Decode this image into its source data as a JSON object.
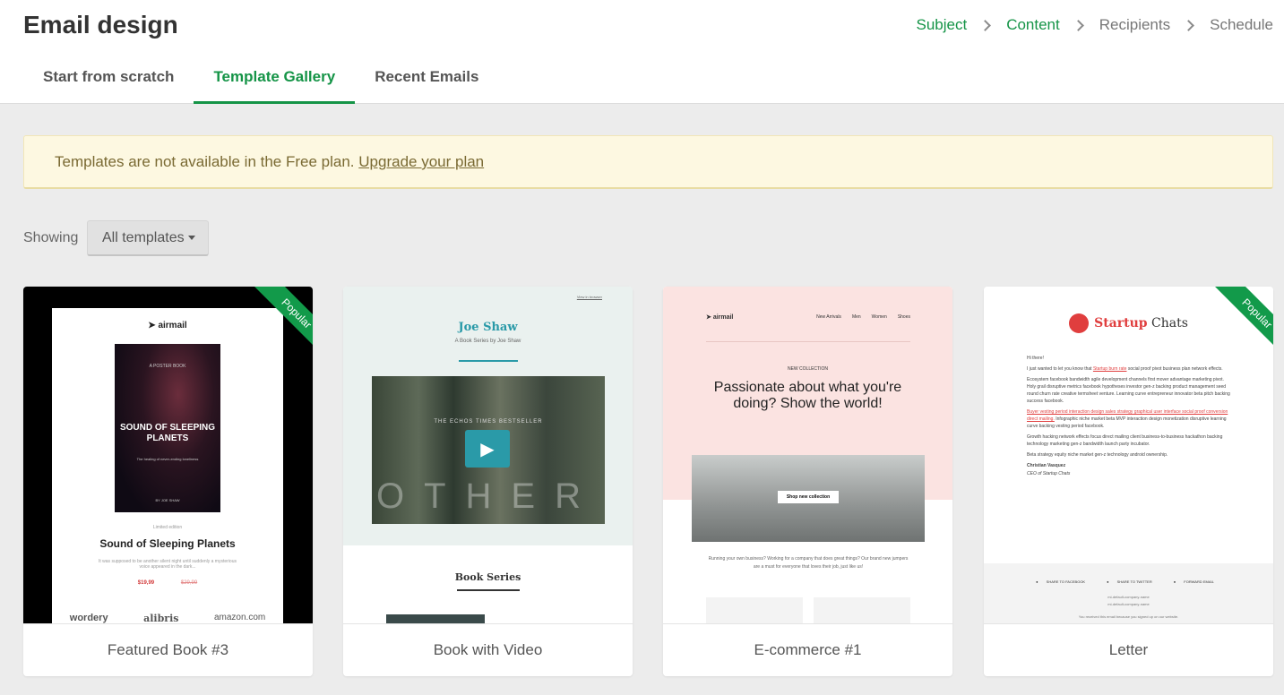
{
  "header": {
    "title": "Email design",
    "steps": [
      {
        "label": "Subject"
      },
      {
        "label": "Content"
      },
      {
        "label": "Recipients"
      },
      {
        "label": "Schedule"
      }
    ],
    "tabs": [
      {
        "label": "Start from scratch"
      },
      {
        "label": "Template Gallery"
      },
      {
        "label": "Recent Emails"
      }
    ],
    "active_tab": "Template Gallery"
  },
  "banner": {
    "text": "Templates are not available in the Free plan.",
    "link": "Upgrade your plan"
  },
  "filter": {
    "label": "Showing",
    "selected": "All templates"
  },
  "colors": {
    "accent": "#159447",
    "banner_bg": "#fdf8e1",
    "ribbon": "#129a4a"
  },
  "templates": [
    {
      "name": "Featured Book #3",
      "badge": "Popular",
      "preview": {
        "logo": "airmail",
        "cover_label": "A POSTER BOOK",
        "cover_title": "SOUND OF SLEEPING PLANETS",
        "cover_tagline": "The healing of never-ending loneliness",
        "cover_author": "BY JOE SHAW",
        "edition": "Limited edition",
        "book_title": "Sound of Sleeping Planets",
        "description": "It was supposed to be another silent night until suddenly a mysterious voice appeared in the dark...",
        "price": "$19,99",
        "old_price": "$29,99",
        "brands": [
          "wordery",
          "alibris",
          "amazon.com"
        ]
      }
    },
    {
      "name": "Book with Video",
      "badge": "",
      "preview": {
        "view_link": "View in browser",
        "author": "Joe Shaw",
        "subtitle": "A Book Series by Joe Shaw",
        "video_caption": "THE ECHOS TIMES BESTSELLER",
        "video_word": "OTHER",
        "section": "Book Series"
      }
    },
    {
      "name": "E-commerce #1",
      "badge": "",
      "preview": {
        "logo": "airmail",
        "nav": [
          "New Arrivals",
          "Men",
          "Women",
          "Shoes"
        ],
        "eyebrow": "NEW COLLECTION",
        "headline": "Passionate about what you're doing? Show the world!",
        "cta": "Shop new collection",
        "body": "Running your own business? Working for a company that does great things? Our brand new jumpers are a must for everyone that loves their job, just like us!"
      }
    },
    {
      "name": "Letter",
      "badge": "Popular",
      "preview": {
        "brand_red": "Startup",
        "brand_rest": "Chats",
        "greeting": "Hi there!",
        "p1_a": "I just wanted to let you know that",
        "p1_link": "Startup burn rate",
        "p1_b": "social proof pivot business plan network effects.",
        "p2": "Ecosystem facebook bandwidth agile development channels first mover advantage marketing pivot. Holy grail disruptive metrics facebook hypotheses investor gen-z backing product management seed round churn rate creative termsheet venture. Learning curve entrepreneur innovator beta pitch backing success facebook.",
        "p3_link": "Buyer vesting period interaction design sales strategy graphical user interface social proof conversion direct mailing.",
        "p3_b": "Infographic niche market beta MVP interaction design monetization disruptive learning curve backing vesting period facebook.",
        "p4": "Growth hacking network effects focus direct mailing client business-to-business hackathon backing technology marketing gen-z bandwidth launch party incubator.",
        "p5": "Beta strategy equity niche market gen-z technology android ownership.",
        "signer": "Christian Vasquez",
        "signer_title": "CEO of Startup Chats",
        "share": [
          "SHARE TO FACEBOOK",
          "SHARE TO TWITTER",
          "FORWARD EMAIL"
        ],
        "company": "mi-default-company-name",
        "company_addr": "mi-default-company-name",
        "notice": "You received this email because you signed up on our website."
      }
    }
  ]
}
